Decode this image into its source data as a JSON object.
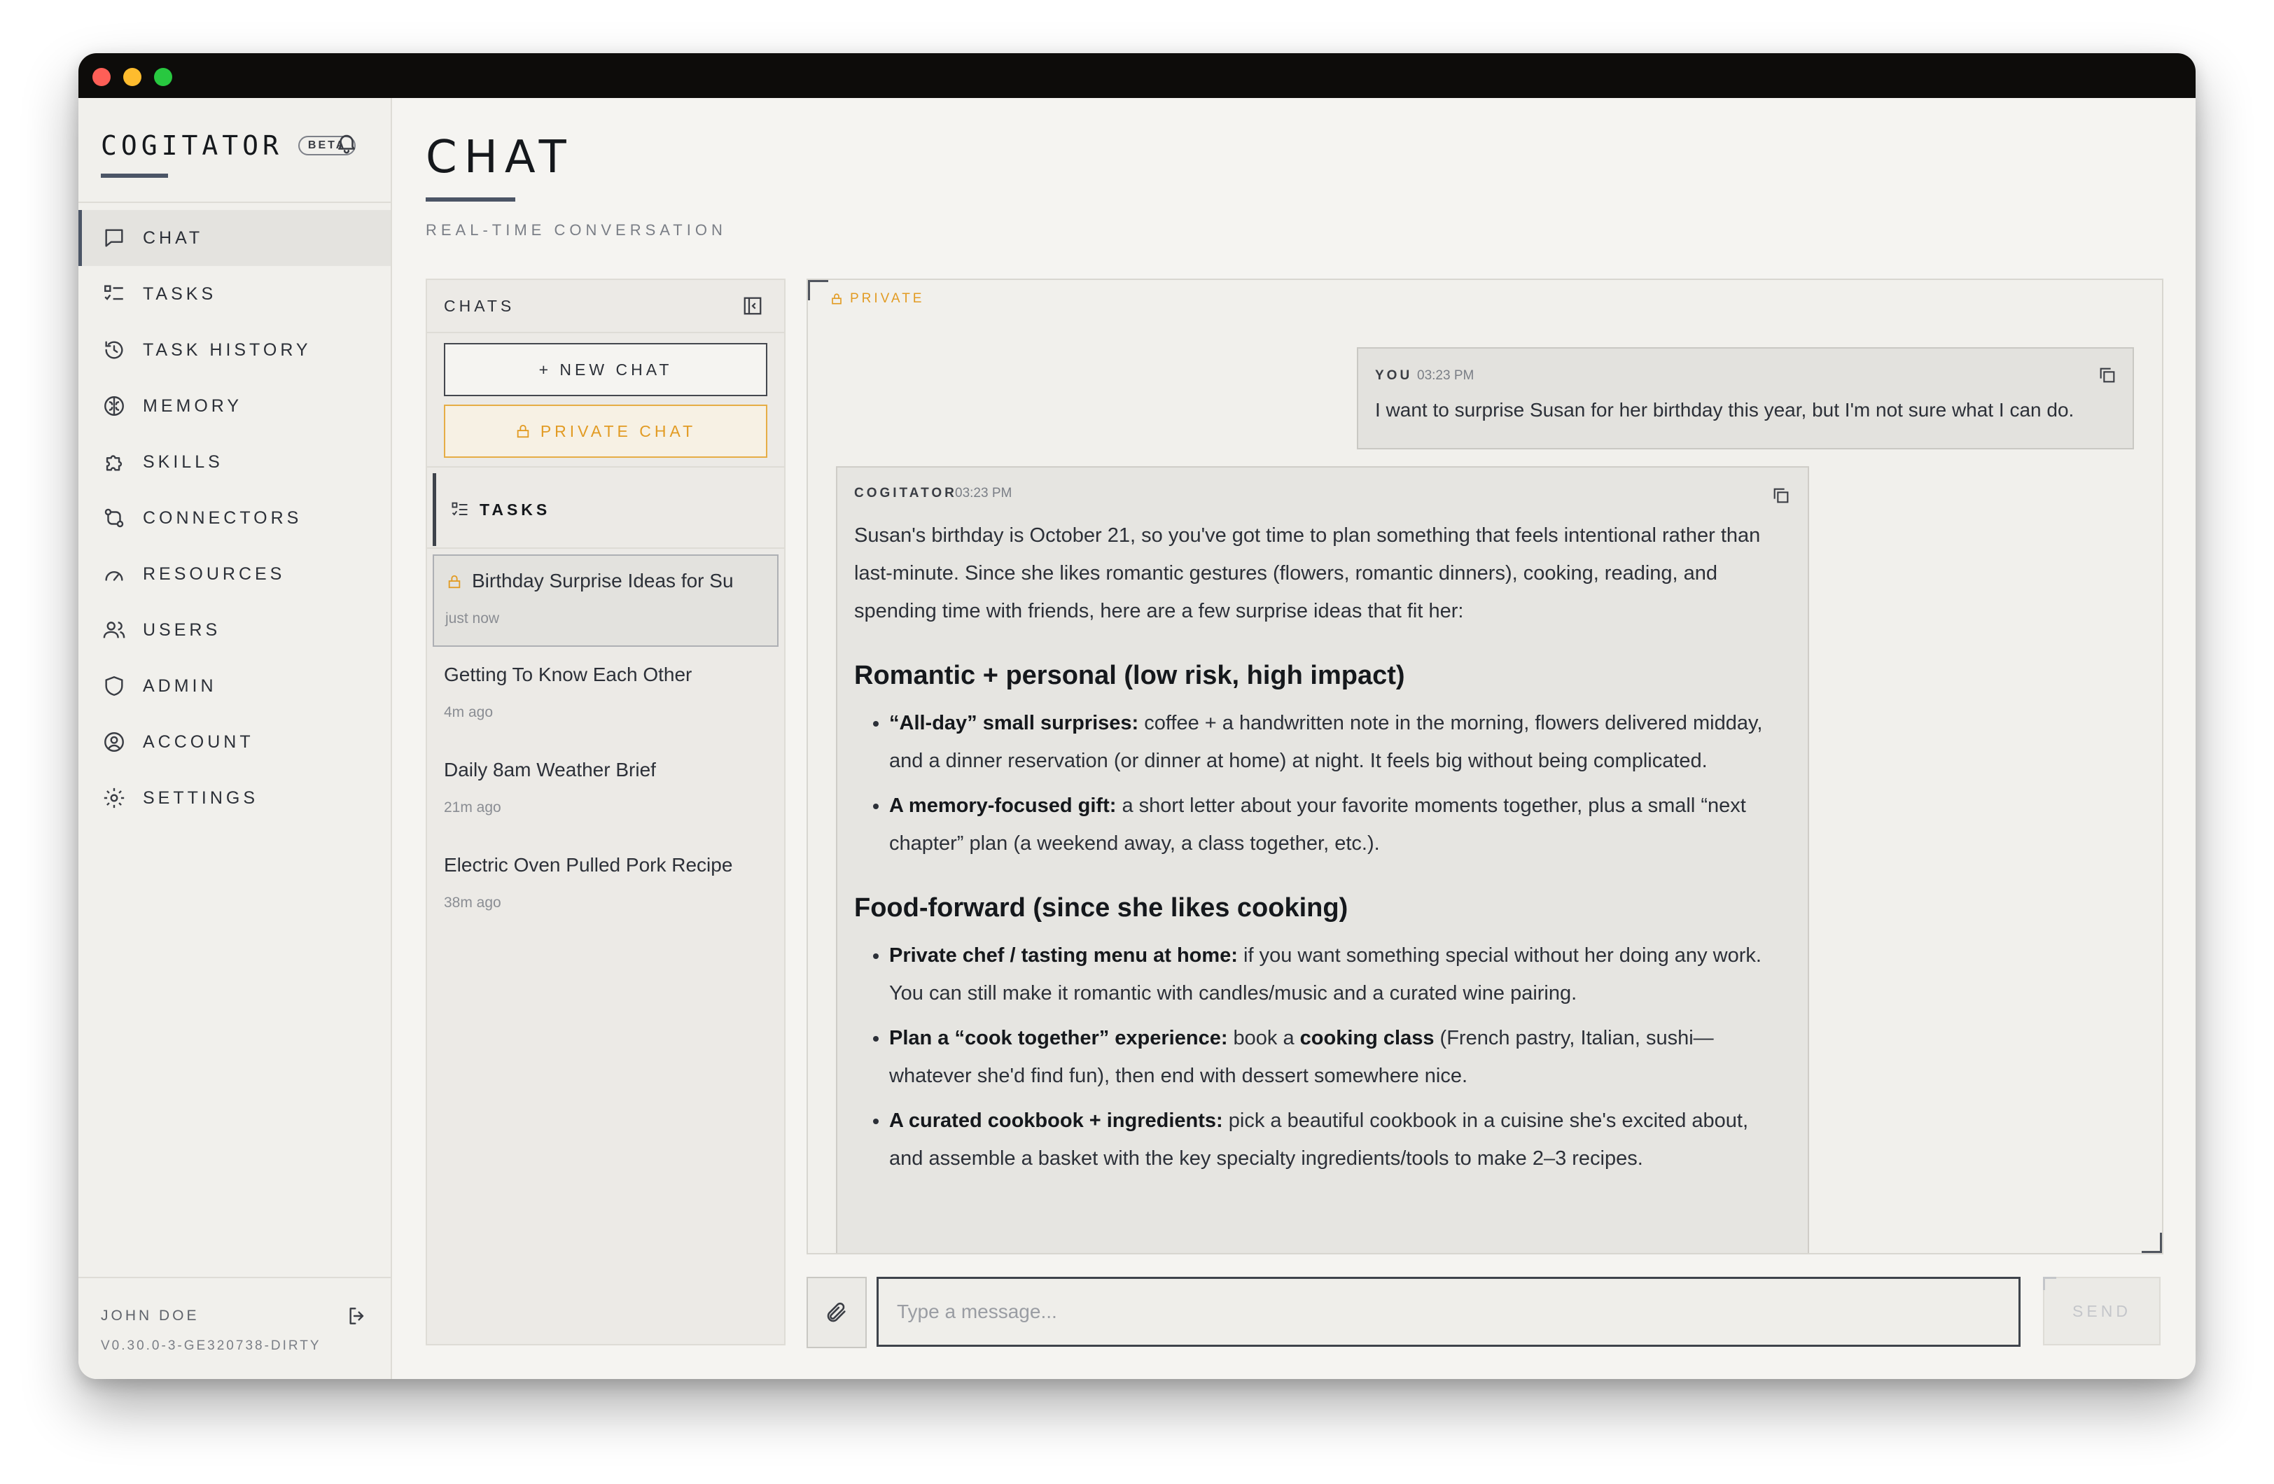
{
  "app": {
    "name": "COGITATOR",
    "badge": "BETA"
  },
  "sidebar": {
    "items": [
      {
        "label": "CHAT",
        "icon": "chat-bubble-icon",
        "active": true
      },
      {
        "label": "TASKS",
        "icon": "tasks-list-icon"
      },
      {
        "label": "TASK HISTORY",
        "icon": "history-icon"
      },
      {
        "label": "MEMORY",
        "icon": "brain-icon"
      },
      {
        "label": "SKILLS",
        "icon": "puzzle-icon"
      },
      {
        "label": "CONNECTORS",
        "icon": "connector-icon"
      },
      {
        "label": "RESOURCES",
        "icon": "gauge-icon"
      },
      {
        "label": "USERS",
        "icon": "users-icon"
      },
      {
        "label": "ADMIN",
        "icon": "shield-icon"
      },
      {
        "label": "ACCOUNT",
        "icon": "account-circle-icon"
      },
      {
        "label": "SETTINGS",
        "icon": "gear-icon"
      }
    ],
    "user_name": "JOHN DOE",
    "version": "V0.30.0-3-GE320738-DIRTY"
  },
  "page": {
    "title": "CHAT",
    "subtitle": "REAL-TIME CONVERSATION"
  },
  "chats_panel": {
    "header": "CHATS",
    "new_chat_label": "+ NEW CHAT",
    "private_chat_label": "PRIVATE CHAT",
    "tasks_label": "TASKS",
    "chats": [
      {
        "title": "Birthday Surprise Ideas for Su",
        "time": "just now",
        "private": true,
        "selected": true
      },
      {
        "title": "Getting To Know Each Other",
        "time": "4m ago"
      },
      {
        "title": "Daily 8am Weather Brief",
        "time": "21m ago"
      },
      {
        "title": "Electric Oven Pulled Pork Recipe",
        "time": "38m ago"
      }
    ]
  },
  "conversation": {
    "private_tag": "PRIVATE",
    "user_message": {
      "sender": "YOU",
      "time": "03:23 PM",
      "text": "I want to surprise Susan for her birthday this year, but I'm not sure what I can do."
    },
    "assistant_message": {
      "sender": "COGITATOR",
      "time": "03:23 PM",
      "intro": "Susan's birthday is October 21, so you've got time to plan something that feels intentional rather than last-minute. Since she likes romantic gestures (flowers, romantic dinners), cooking, reading, and spending time with friends, here are a few surprise ideas that fit her:",
      "section1_heading": "Romantic + personal (low risk, high impact)",
      "s1_b1_bold": "“All-day” small surprises:",
      "s1_b1_text": " coffee + a handwritten note in the morning, flowers delivered midday, and a dinner reservation (or dinner at home) at night. It feels big without being complicated.",
      "s1_b2_bold": "A memory-focused gift:",
      "s1_b2_text": " a short letter about your favorite moments together, plus a small “next chapter” plan (a weekend away, a class together, etc.).",
      "section2_heading": "Food-forward (since she likes cooking)",
      "s2_b1_bold": "Private chef / tasting menu at home:",
      "s2_b1_text": " if you want something special without her doing any work. You can still make it romantic with candles/music and a curated wine pairing.",
      "s2_b2_bold": "Plan a “cook together” experience:",
      "s2_b2_pre": " book a ",
      "s2_b2_bold2": "cooking class",
      "s2_b2_text": " (French pastry, Italian, sushi—whatever she'd find fun), then end with dessert somewhere nice.",
      "s2_b3_bold": "A curated cookbook + ingredients:",
      "s2_b3_text": " pick a beautiful cookbook in a cuisine she's excited about, and assemble a basket with the key specialty ingredients/tools to make 2–3 recipes."
    }
  },
  "composer": {
    "placeholder": "Type a message...",
    "send_label": "SEND"
  },
  "colors": {
    "accent": "#4b5566",
    "private": "#e29b23",
    "background": "#f5f4f1",
    "titlebar": "#0d0c0a"
  }
}
